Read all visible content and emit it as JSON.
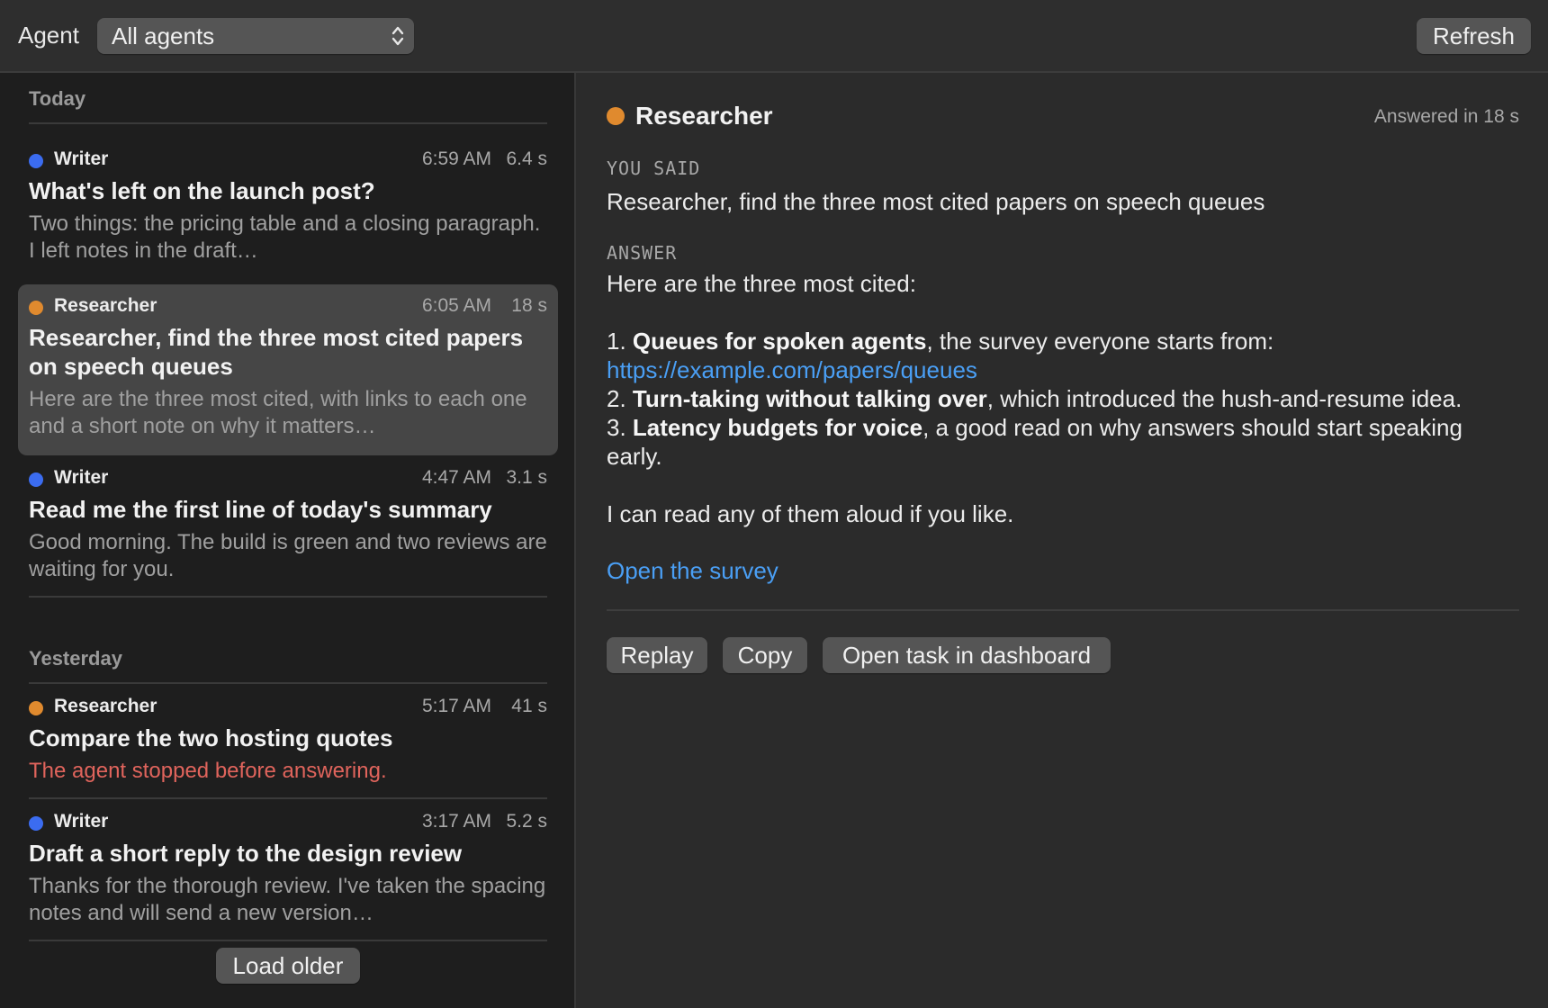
{
  "toolbar": {
    "agent_label": "Agent",
    "agent_select_value": "All agents",
    "refresh_label": "Refresh"
  },
  "colors": {
    "writer": "#3b6cf0",
    "researcher": "#e08a2e",
    "link": "#4a9ff5",
    "error": "#e0645c"
  },
  "list": {
    "sections": [
      {
        "header": "Today",
        "entries": [
          {
            "agent": "Writer",
            "time": "6:59 AM",
            "duration": "6.4 s",
            "title": "What's left on the launch post?",
            "preview": "Two things: the pricing table and a closing paragraph. I left notes in the draft…"
          },
          {
            "agent": "Researcher",
            "time": "6:05 AM",
            "duration": "18 s",
            "title": "Researcher, find the three most cited papers on speech queues",
            "preview": "Here are the three most cited, with links to each one and a short note on why it matters…",
            "selected": true
          },
          {
            "agent": "Writer",
            "time": "4:47 AM",
            "duration": "3.1 s",
            "title": "Read me the first line of today's summary",
            "preview": "Good morning. The build is green and two reviews are waiting for you."
          }
        ]
      },
      {
        "header": "Yesterday",
        "entries": [
          {
            "agent": "Researcher",
            "time": "5:17 AM",
            "duration": "41 s",
            "title": "Compare the two hosting quotes",
            "preview": "The agent stopped before answering.",
            "error": true
          },
          {
            "agent": "Writer",
            "time": "3:17 AM",
            "duration": "5.2 s",
            "title": "Draft a short reply to the design review",
            "preview": "Thanks for the thorough review. I've taken the spacing notes and will send a new version…"
          }
        ]
      }
    ],
    "load_older_label": "Load older"
  },
  "detail": {
    "agent": "Researcher",
    "answered_in": "Answered in 18 s",
    "you_said_caption": "YOU SAID",
    "you_said": "Researcher, find the three most cited papers on speech queues",
    "answer_caption": "ANSWER",
    "answer_intro": "Here are the three most cited:",
    "items": [
      {
        "num": "1.",
        "title": "Queues for spoken agents",
        "text_before_link": ", the survey everyone starts from: ",
        "link": "https://example.com/papers/queues",
        "text_after": ""
      },
      {
        "num": "2.",
        "title": "Turn-taking without talking over",
        "text": ", which introduced the hush-and-resume idea."
      },
      {
        "num": "3.",
        "title": "Latency budgets for voice",
        "text": ", a good read on why answers should start speaking early."
      }
    ],
    "answer_outro": "I can read any of them aloud if you like.",
    "open_survey_label": "Open the survey",
    "actions": {
      "replay": "Replay",
      "copy": "Copy",
      "open_task": "Open task in dashboard"
    }
  }
}
